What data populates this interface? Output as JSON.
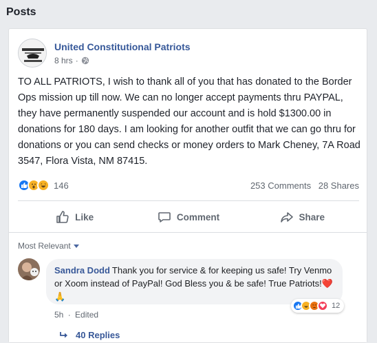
{
  "section": {
    "title": "Posts"
  },
  "post": {
    "page_name": "United Constitutional Patriots",
    "time": "8 hrs",
    "separator": "·",
    "audience_icon": "globe-icon",
    "text": "TO ALL PATRIOTS, I wish to thank all of you that has donated to the Border Ops mission up till now. We can no longer accept payments thru PAYPAL, they have permanently suspended our account and is hold $1300.00 in donations for 180 days. I am looking for another outfit that we can go thru for donations or you can send checks or money orders to Mark Cheney, 7A Road 3547, Flora Vista, NM 87415.",
    "reactions": {
      "icons": [
        "like-icon",
        "wow-icon",
        "haha-icon"
      ],
      "count": "146"
    },
    "comments_count": "253 Comments",
    "shares_count": "28 Shares"
  },
  "actions": {
    "like": "Like",
    "comment": "Comment",
    "share": "Share"
  },
  "comments_section": {
    "sort_label": "Most Relevant",
    "comment": {
      "author": "Sandra Dodd",
      "text": "Thank you for service & for keeping us safe! Try Venmo or Xoom instead of PayPal! God Bless you & be safe! True Patriots!",
      "emoji": "❤️🙏",
      "reactions": {
        "icons": [
          "like-icon",
          "haha-icon",
          "angry-icon",
          "love-icon"
        ],
        "count": "12"
      },
      "time": "5h",
      "separator": "·",
      "edited": "Edited"
    },
    "replies_label": "40 Replies"
  },
  "colors": {
    "link": "#365899",
    "like_blue": "#1877f2",
    "text": "#1d2129",
    "muted": "#606770"
  }
}
